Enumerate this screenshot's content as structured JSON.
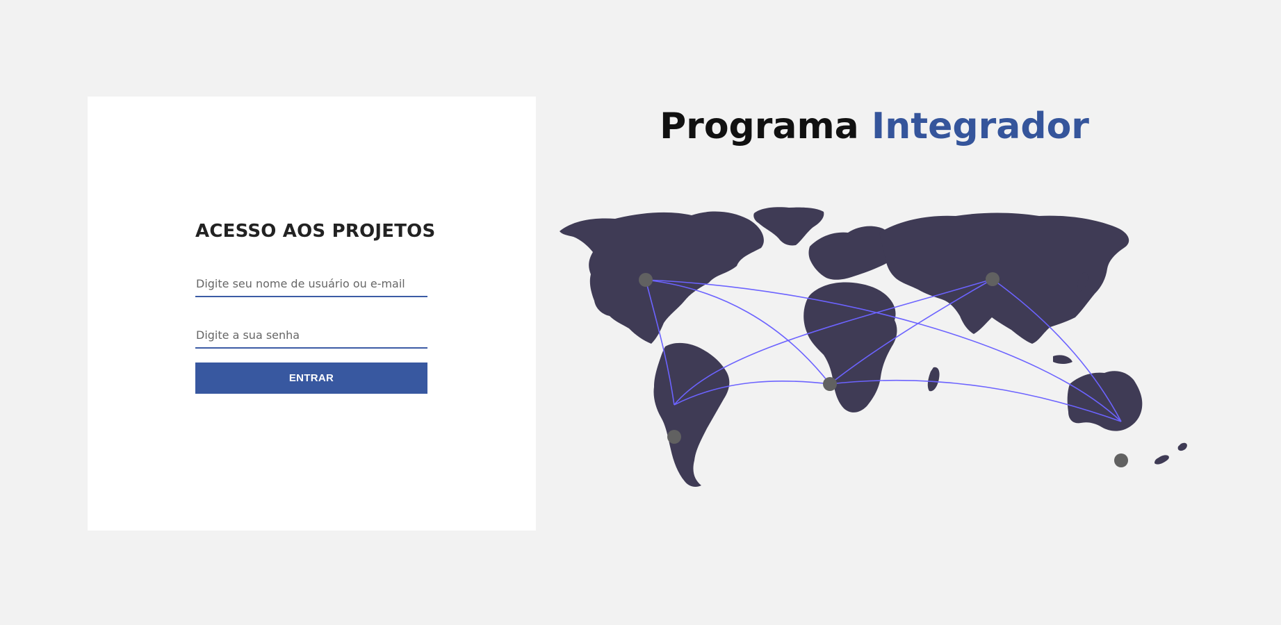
{
  "login": {
    "heading": "ACESSO AOS PROJETOS",
    "username_placeholder": "Digite seu nome de usuário ou e-mail",
    "password_placeholder": "Digite a sua senha",
    "submit_label": "ENTRAR"
  },
  "brand": {
    "title_part1": "Programa",
    "title_part2": "Integrador",
    "accent_color": "#35559b"
  },
  "illustration": {
    "name": "world-map-icon",
    "continent_color": "#3f3b55",
    "route_color": "#6c63ff",
    "node_color": "#616161"
  },
  "colors": {
    "page_background": "#f2f2f2",
    "card_background": "#ffffff",
    "button_background": "#3858a0"
  }
}
